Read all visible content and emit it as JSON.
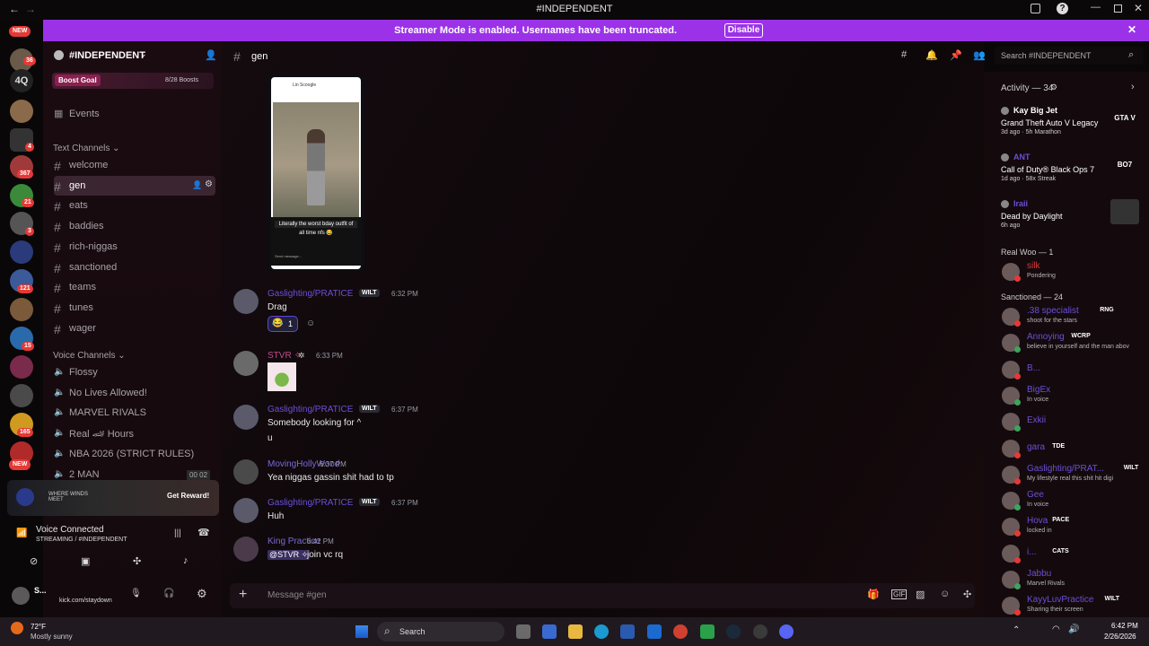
{
  "window": {
    "title": "#INDEPENDENT"
  },
  "banner": {
    "text": "Streamer Mode is enabled. Usernames have been truncated.",
    "button": "Disable"
  },
  "guilds": {
    "new_top": "NEW",
    "b1": "36",
    "label4q": "4Q",
    "b2": "4",
    "b3": "367",
    "b4": "21",
    "b5": "3",
    "b6": "121",
    "b7": "15",
    "b8": "165",
    "new_bottom": "NEW"
  },
  "server": {
    "name": "#INDEPENDENT",
    "boost_goal": "Boost Goal",
    "boosts": "8/28 Boosts",
    "events": "Events"
  },
  "text_channels": {
    "header": "Text Channels",
    "items": [
      "welcome",
      "gen",
      "eats",
      "baddies",
      "rich-niggas",
      "sanctioned",
      "teams",
      "tunes",
      "wager"
    ]
  },
  "voice_channels": {
    "header": "Voice Channels",
    "items": [
      "Flossy",
      "No Lives Allowed!",
      "MARVEL RIVALS",
      "Real 🏎 Hours",
      "NBA 2026 (STRICT RULES)",
      "2 MAN"
    ],
    "count": "00  02"
  },
  "promo": {
    "text": "WHERE WINDS MEET",
    "button": "Get Reward!"
  },
  "voice": {
    "status": "Voice Connected",
    "sub": "STREAMING / #INDEPENDENT"
  },
  "user": {
    "name": "S...",
    "status": "kick.com/staydown"
  },
  "channel_header": {
    "name": "gen",
    "search_placeholder": "Search #INDEPENDENT"
  },
  "post": {
    "line1": "Literally the worst bday outfit of",
    "line2": "all time nfs 😂",
    "top": "Lin Scoogle",
    "send": "Send message..."
  },
  "messages": [
    {
      "author": "Gaslighting/PRATICE",
      "tag": "WILT",
      "time": "6:32 PM",
      "text": "Drag",
      "reaction": "1"
    },
    {
      "author": "STVR ✧",
      "tag": "",
      "time": "6:33 PM",
      "text": ""
    },
    {
      "author": "Gaslighting/PRATICE",
      "tag": "WILT",
      "time": "6:37 PM",
      "text": "Somebody looking for ^",
      "text2": "u"
    },
    {
      "author": "MovingHollyWood",
      "tag": "",
      "time": "6:37 PM",
      "text": "Yea niggas gassin shit had to tp"
    },
    {
      "author": "Gaslighting/PRATICE",
      "tag": "WILT",
      "time": "6:37 PM",
      "text": "Huh"
    },
    {
      "author": "King Practice",
      "tag": "",
      "time": "6:42 PM",
      "mention": "@STVR ✧",
      "text": "join vc rq"
    }
  ],
  "composer": {
    "placeholder": "Message #gen"
  },
  "activity": {
    "header": "Activity — 34",
    "items": [
      {
        "user": "Kay Big Jet",
        "game": "Grand Theft Auto V Legacy",
        "meta": "3d ago  ·  5h Marathon",
        "art": "GTA V"
      },
      {
        "user": "ANT",
        "game": "Call of Duty® Black Ops 7",
        "meta": "1d ago  ·  58x Streak",
        "art": "BO7"
      },
      {
        "user": "Iraii",
        "game": "Dead by Daylight",
        "meta": "6h ago",
        "art": ""
      }
    ]
  },
  "member_groups": [
    {
      "header": "Real Woo — 1",
      "members": [
        {
          "name": "silk",
          "sub": "Pondering",
          "color": "#d83a3a"
        }
      ]
    },
    {
      "header": "Sanctioned — 24",
      "members": [
        {
          "name": ".38 specialist",
          "tag": "RNG",
          "sub": "shoot for the stars",
          "color": "#6b4fd8"
        },
        {
          "name": "Annoying",
          "tag": "WCRP",
          "sub": "believe in yourself and the man abov",
          "color": "#6b4fd8"
        },
        {
          "name": "B...",
          "sub": "",
          "color": "#6b4fd8"
        },
        {
          "name": "BigEx",
          "sub": "In voice",
          "color": "#6b4fd8"
        },
        {
          "name": "Exkii",
          "sub": "",
          "color": "#6b4fd8"
        },
        {
          "name": "gara",
          "tag": "TDE",
          "sub": "",
          "color": "#6b4fd8"
        },
        {
          "name": "Gaslighting/PRAT...",
          "tag": "WILT",
          "sub": "My lifestyle real this shit hit digi",
          "color": "#6b4fd8"
        },
        {
          "name": "Gee",
          "sub": "In voice",
          "color": "#6b4fd8"
        },
        {
          "name": "Hova",
          "tag": "PACE",
          "sub": "locked in",
          "color": "#6b4fd8"
        },
        {
          "name": "i...",
          "tag": "CATS",
          "sub": "",
          "color": "#6b4fd8"
        },
        {
          "name": "Jabbu",
          "sub": "Marvel Rivals",
          "color": "#6b4fd8"
        },
        {
          "name": "KayyLuvPractice",
          "tag": "WILT",
          "sub": "Sharing their screen",
          "color": "#6b4fd8"
        }
      ]
    }
  ],
  "taskbar": {
    "temp": "72°F",
    "weather": "Mostly sunny",
    "search": "Search",
    "time": "6:42 PM",
    "date": "2/26/2026"
  }
}
